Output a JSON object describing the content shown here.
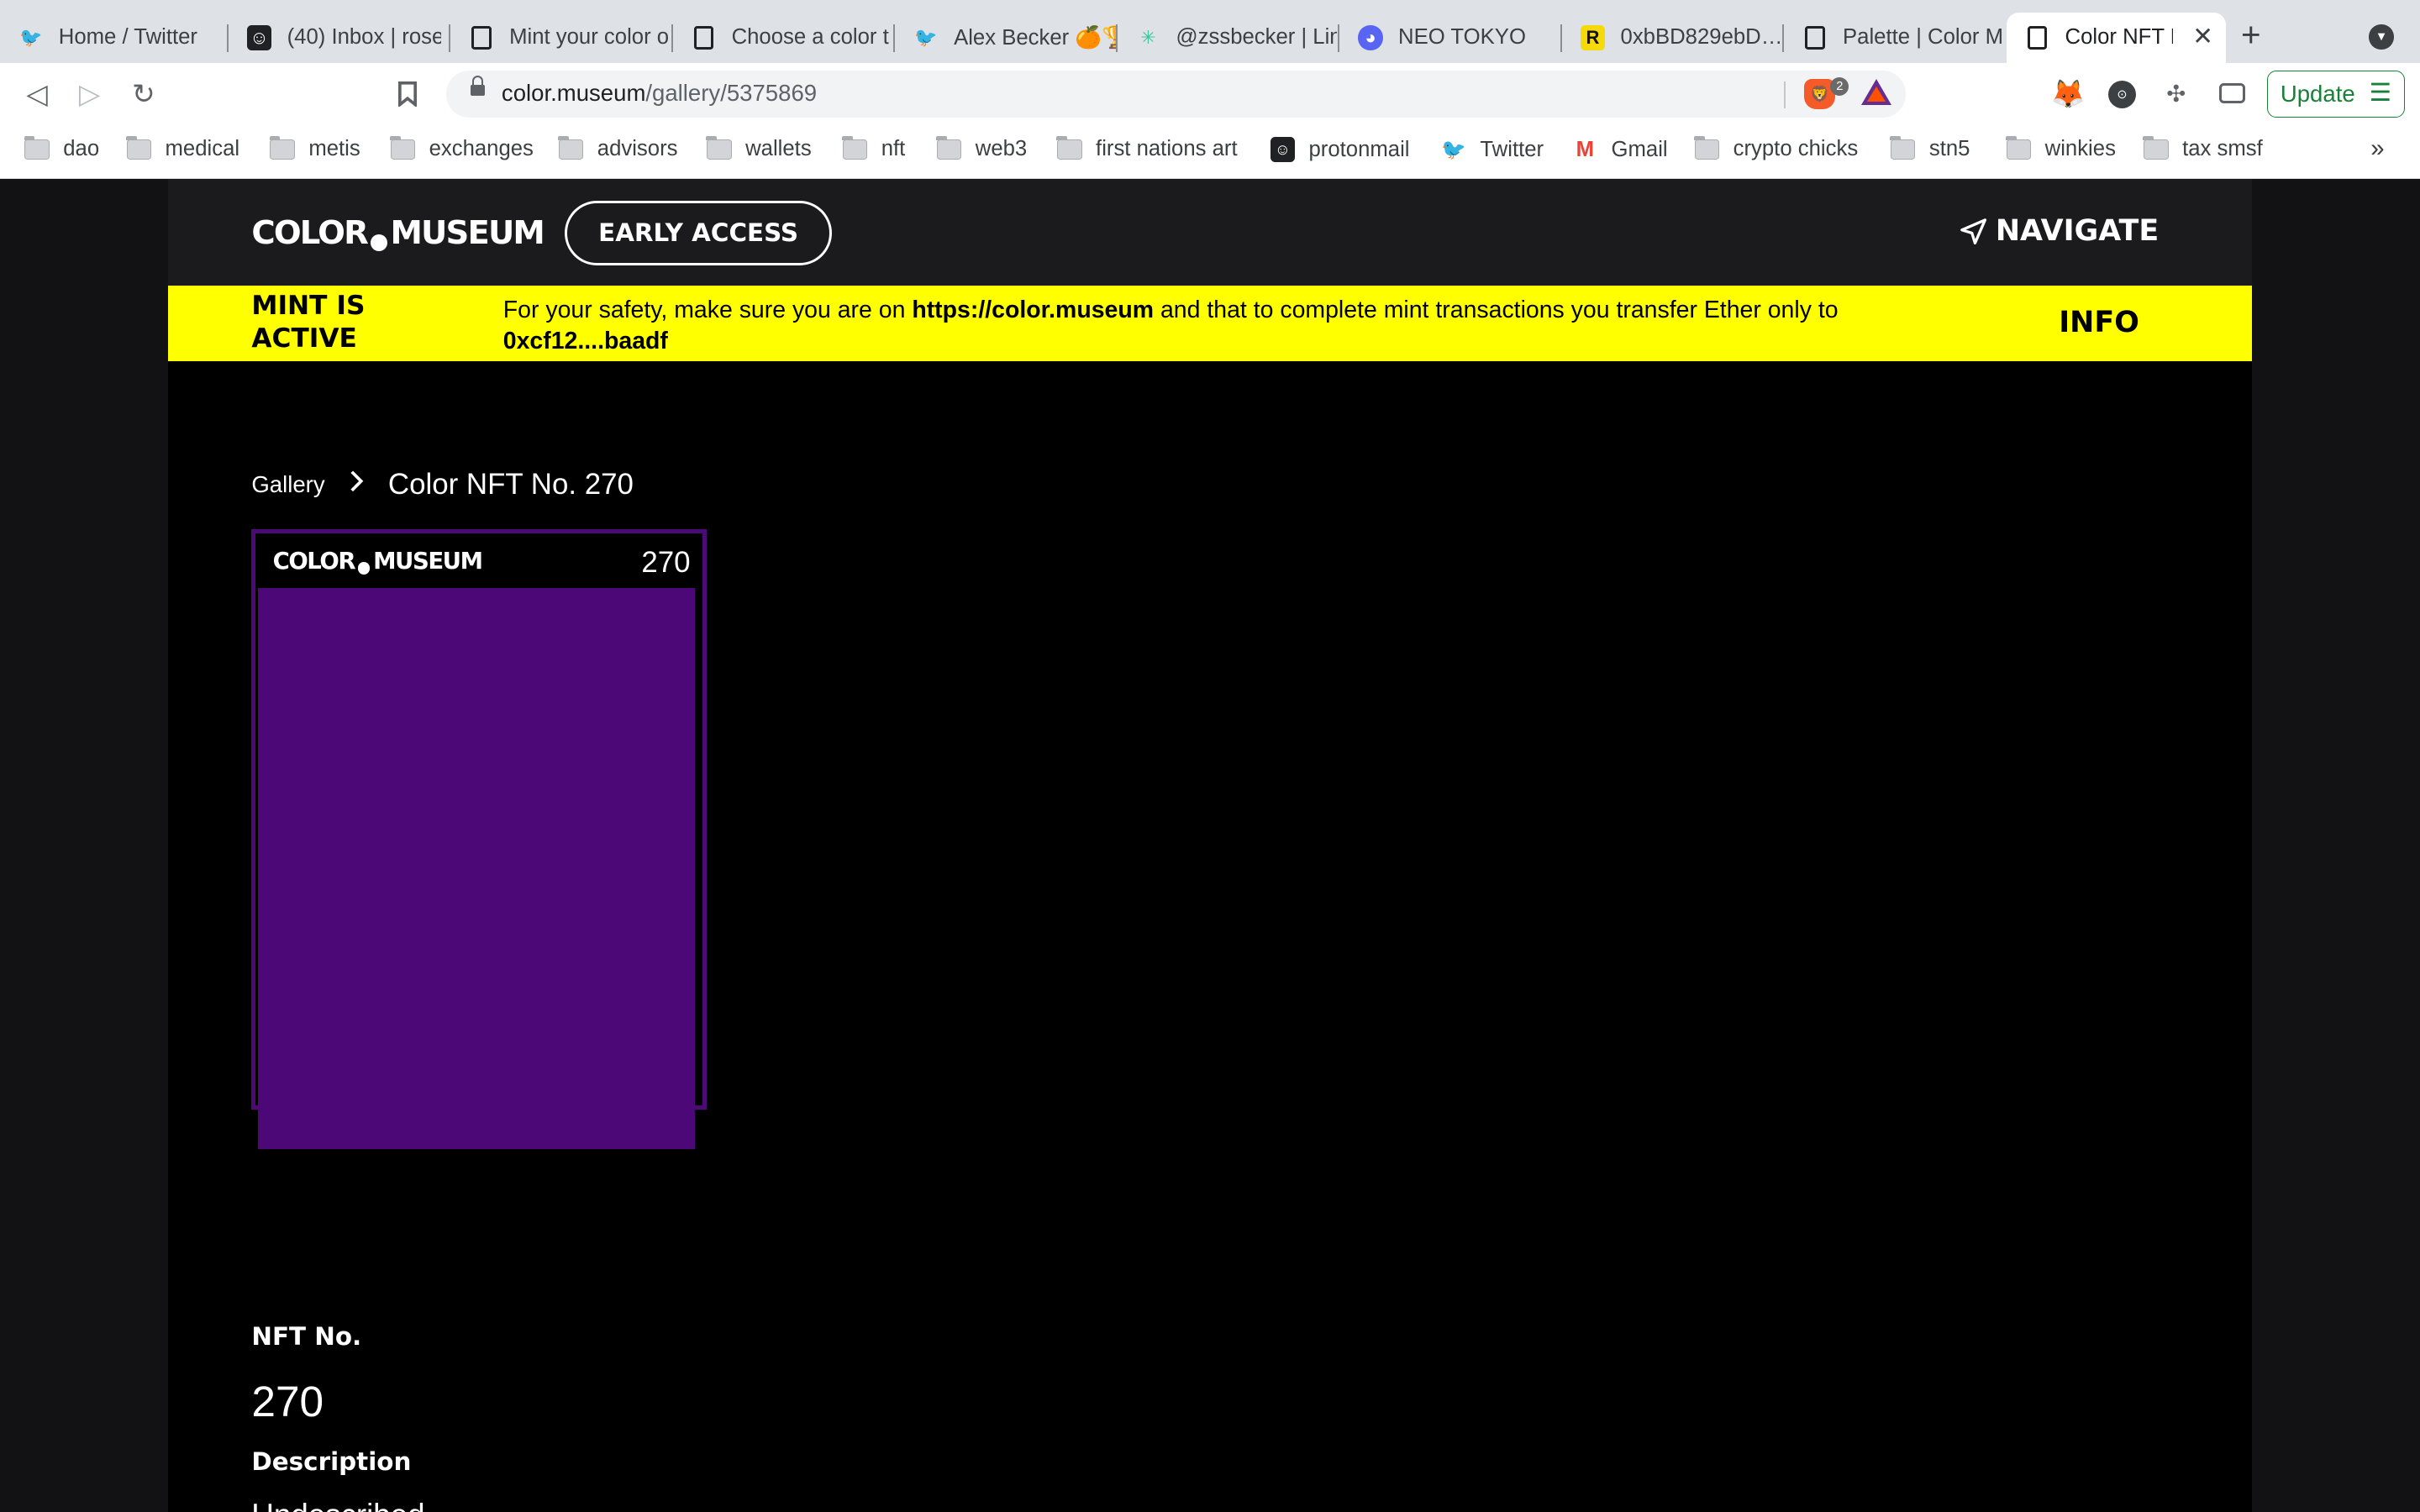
{
  "browser": {
    "tabs": [
      {
        "title": "Home / Twitter",
        "icon": "twitter-icon"
      },
      {
        "title": "(40) Inbox | rose",
        "icon": "protonmail-icon"
      },
      {
        "title": "Mint your color o",
        "icon": "page-icon"
      },
      {
        "title": "Choose a color t",
        "icon": "page-icon"
      },
      {
        "title": "Alex Becker 🍊🏆",
        "icon": "twitter-icon"
      },
      {
        "title": "@zssbecker | Lin",
        "icon": "linktree-icon"
      },
      {
        "title": "NEO TOKYO",
        "icon": "discord-icon"
      },
      {
        "title": "0xbBD829ebD…",
        "icon": "rarible-icon"
      },
      {
        "title": "Palette | Color M",
        "icon": "page-icon"
      },
      {
        "title": "Color NFT No",
        "icon": "page-icon",
        "active": true
      }
    ],
    "url_host": "color.museum",
    "url_path": "/gallery/5375869",
    "brave_badge": "2",
    "update_label": "Update",
    "bookmarks": [
      {
        "label": "dao",
        "icon": "folder-icon"
      },
      {
        "label": "medical",
        "icon": "folder-icon"
      },
      {
        "label": "metis",
        "icon": "folder-icon"
      },
      {
        "label": "exchanges",
        "icon": "folder-icon"
      },
      {
        "label": "advisors",
        "icon": "folder-icon"
      },
      {
        "label": "wallets",
        "icon": "folder-icon"
      },
      {
        "label": "nft",
        "icon": "folder-icon"
      },
      {
        "label": "web3",
        "icon": "folder-icon"
      },
      {
        "label": "first nations art",
        "icon": "folder-icon"
      },
      {
        "label": "protonmail",
        "icon": "protonmail-icon"
      },
      {
        "label": "Twitter",
        "icon": "twitter-icon"
      },
      {
        "label": "Gmail",
        "icon": "gmail-icon"
      },
      {
        "label": "crypto chicks",
        "icon": "folder-icon"
      },
      {
        "label": "stn5",
        "icon": "folder-icon"
      },
      {
        "label": "winkies",
        "icon": "folder-icon"
      },
      {
        "label": "tax smsf",
        "icon": "folder-icon"
      }
    ]
  },
  "site": {
    "logo_left": "COLOR",
    "logo_right": "MUSEUM",
    "early_access": "EARLY ACCESS",
    "navigate": "NAVIGATE",
    "banner": {
      "mint_status": "MINT IS ACTIVE",
      "notice_1": "For your safety, make sure you are on ",
      "notice_url": "https://color.museum",
      "notice_2": " and that to complete mint transactions you transfer Ether only to ",
      "notice_address": "0xcf12....baadf",
      "info": "INFO"
    },
    "breadcrumb": {
      "root": "Gallery",
      "current": "Color NFT No. 270"
    },
    "card": {
      "number": "270",
      "color": "#4b0876",
      "border_color": "#4b0a76"
    },
    "details": {
      "nft_no_label": "NFT No.",
      "nft_no_value": "270",
      "description_label": "Description",
      "description_value": "Undescribed"
    }
  }
}
